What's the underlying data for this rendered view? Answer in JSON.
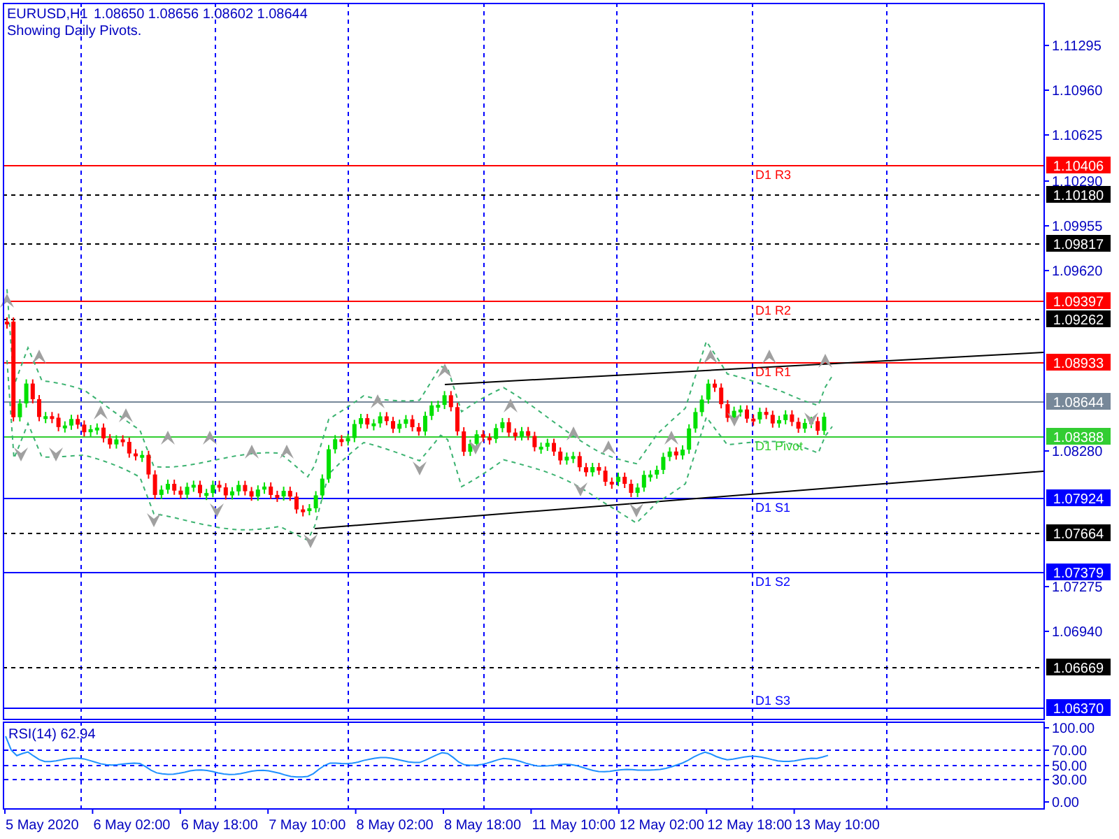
{
  "header": {
    "symbol": "EURUSD,H1",
    "quote": "1.08650 1.08656 1.08602 1.08644",
    "note": "Showing Daily Pivots."
  },
  "price_axis": {
    "ticks": [
      "1.11295",
      "1.10960",
      "1.10625",
      "1.10290",
      "1.09955",
      "1.09620",
      "1.08280",
      "1.07275",
      "1.06940"
    ]
  },
  "levels": [
    {
      "kind": "pivot",
      "label": "D1 R3",
      "price": "1.10406",
      "color": "#ff0000"
    },
    {
      "kind": "grid",
      "price": "1.10180",
      "color": "#000000"
    },
    {
      "kind": "grid",
      "price": "1.09817",
      "color": "#000000"
    },
    {
      "kind": "pivot",
      "label": "D1 R2",
      "price": "1.09397",
      "color": "#ff0000"
    },
    {
      "kind": "grid",
      "price": "1.09262",
      "color": "#000000"
    },
    {
      "kind": "pivot",
      "label": "D1 R1",
      "price": "1.08933",
      "color": "#ff0000"
    },
    {
      "kind": "current",
      "price": "1.08644",
      "color": "#778899"
    },
    {
      "kind": "pivot",
      "label": "D1 Pivot",
      "price": "1.08388",
      "color": "#32cd32"
    },
    {
      "kind": "pivot",
      "label": "D1 S1",
      "price": "1.07924",
      "color": "#0000ff"
    },
    {
      "kind": "grid",
      "price": "1.07664",
      "color": "#000000"
    },
    {
      "kind": "pivot",
      "label": "D1 S2",
      "price": "1.07379",
      "color": "#0000ff"
    },
    {
      "kind": "grid",
      "price": "1.06669",
      "color": "#000000"
    },
    {
      "kind": "pivot",
      "label": "D1 S3",
      "price": "1.06370",
      "color": "#0000ff"
    }
  ],
  "time_axis": {
    "labels": [
      "5 May 2020",
      "6 May 02:00",
      "6 May 18:00",
      "7 May 10:00",
      "8 May 02:00",
      "8 May 18:00",
      "11 May 10:00",
      "12 May 02:00",
      "12 May 18:00",
      "13 May 10:00"
    ]
  },
  "rsi": {
    "title": "RSI(14) 62.94",
    "ticks": [
      "100.00",
      "70.00",
      "50.00",
      "30.00",
      "0.00"
    ]
  }
}
